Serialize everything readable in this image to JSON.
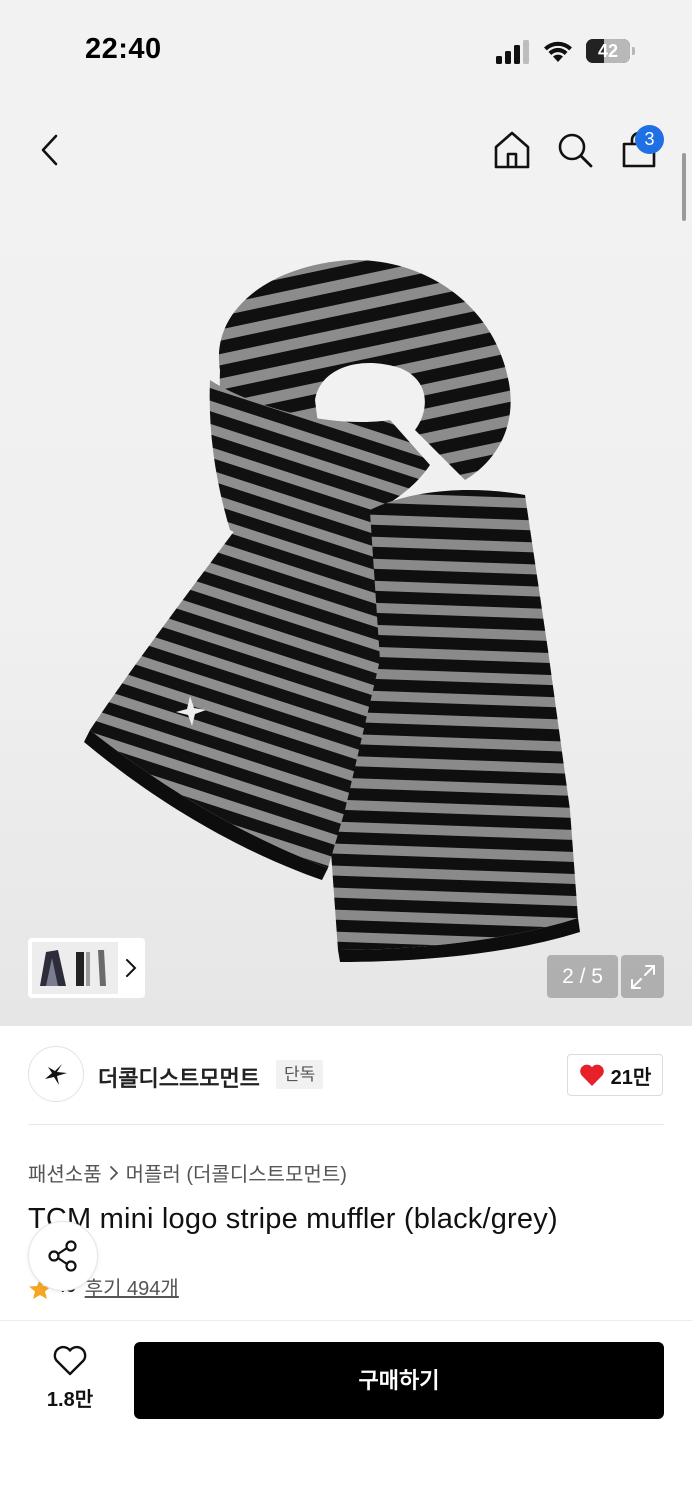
{
  "status_bar": {
    "time": "22:40",
    "battery_level": "42",
    "battery_fraction": 0.42,
    "icons": [
      "signal-icon",
      "wifi-icon",
      "battery-icon"
    ]
  },
  "header": {
    "icons": [
      "back-icon",
      "home-icon",
      "search-icon",
      "cart-icon"
    ],
    "cart_badge": "3"
  },
  "gallery": {
    "page_indicator": "2 / 5",
    "current_page": 2,
    "total_pages": 5,
    "thumbnail_arrow_icon": "chevron-right-icon",
    "expand_icon": "expand-icon"
  },
  "brand": {
    "name": "더콜디스트모먼트",
    "badge": "단독",
    "like_count": "21만",
    "like_icon": "heart-filled-icon",
    "like_color": "#e8202a"
  },
  "product": {
    "breadcrumb": [
      "패션소품",
      "머플러 (더콜디스트모먼트)"
    ],
    "title": "TCM mini logo stripe muffler (black/grey)",
    "rating": "4.9",
    "rating_display": ".9",
    "review_link": "후기 494개",
    "star_color": "#f5a623"
  },
  "share": {
    "icon": "share-icon"
  },
  "bottom_bar": {
    "wish_count": "1.8만",
    "wish_icon": "heart-outline-icon",
    "buy_label": "구매하기",
    "buy_color": "#000000"
  }
}
